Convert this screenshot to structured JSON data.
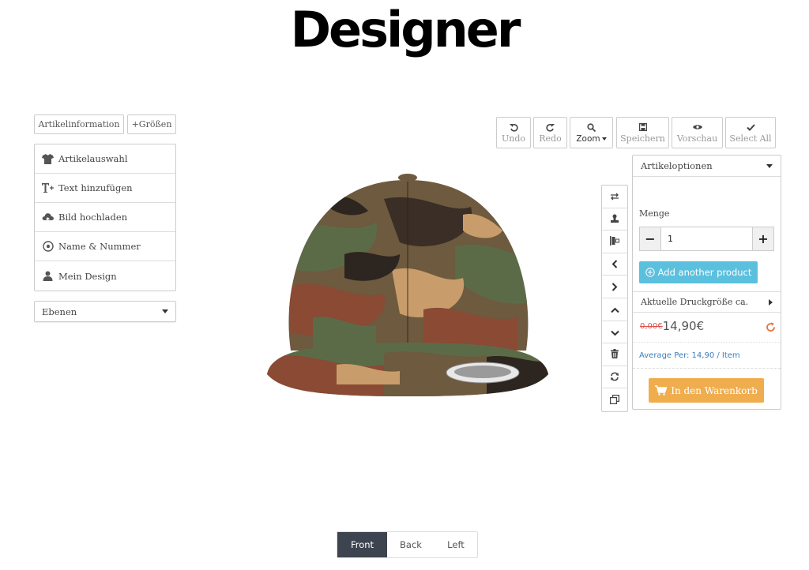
{
  "page": {
    "title": "Designer"
  },
  "top_tabs": {
    "info": "Artikelinformation",
    "sizes": "+Größen"
  },
  "left_menu": {
    "items": [
      {
        "label": "Artikelauswahl",
        "icon": "tshirt-icon"
      },
      {
        "label": "Text hinzufügen",
        "icon": "text-add-icon"
      },
      {
        "label": "Bild hochladen",
        "icon": "cloud-upload-icon"
      },
      {
        "label": "Name & Nummer",
        "icon": "soccer-ball-icon"
      },
      {
        "label": "Mein Design",
        "icon": "user-icon"
      }
    ],
    "layers_label": "Ebenen"
  },
  "toolbar": {
    "undo": "Undo",
    "redo": "Redo",
    "zoom": "Zoom",
    "save": "Speichern",
    "preview": "Vorschau",
    "select_all": "Select All"
  },
  "tools": [
    "swap-icon",
    "stamp-icon",
    "align-icon",
    "chevron-left-icon",
    "chevron-right-icon",
    "chevron-up-icon",
    "chevron-down-icon",
    "trash-icon",
    "refresh-icon",
    "copy-icon"
  ],
  "options_panel": {
    "header": "Artikeloptionen",
    "quantity_label": "Menge",
    "quantity_value": "1",
    "minus": "−",
    "plus": "+",
    "add_product": "Add another product",
    "print_size": "Aktuelle Druckgröße ca.",
    "old_price": "0,00€",
    "price": "14,90€",
    "average": "Average Per: 14,90 / Item",
    "cart": "In den Warenkorb"
  },
  "views": {
    "front": "Front",
    "back": "Back",
    "left": "Left",
    "active": "Front"
  },
  "colors": {
    "info": "#5bc0de",
    "warning": "#f0ad4e",
    "active_tab": "#3d4450",
    "old_price": "#d9534f",
    "link": "#3a7fbf"
  }
}
